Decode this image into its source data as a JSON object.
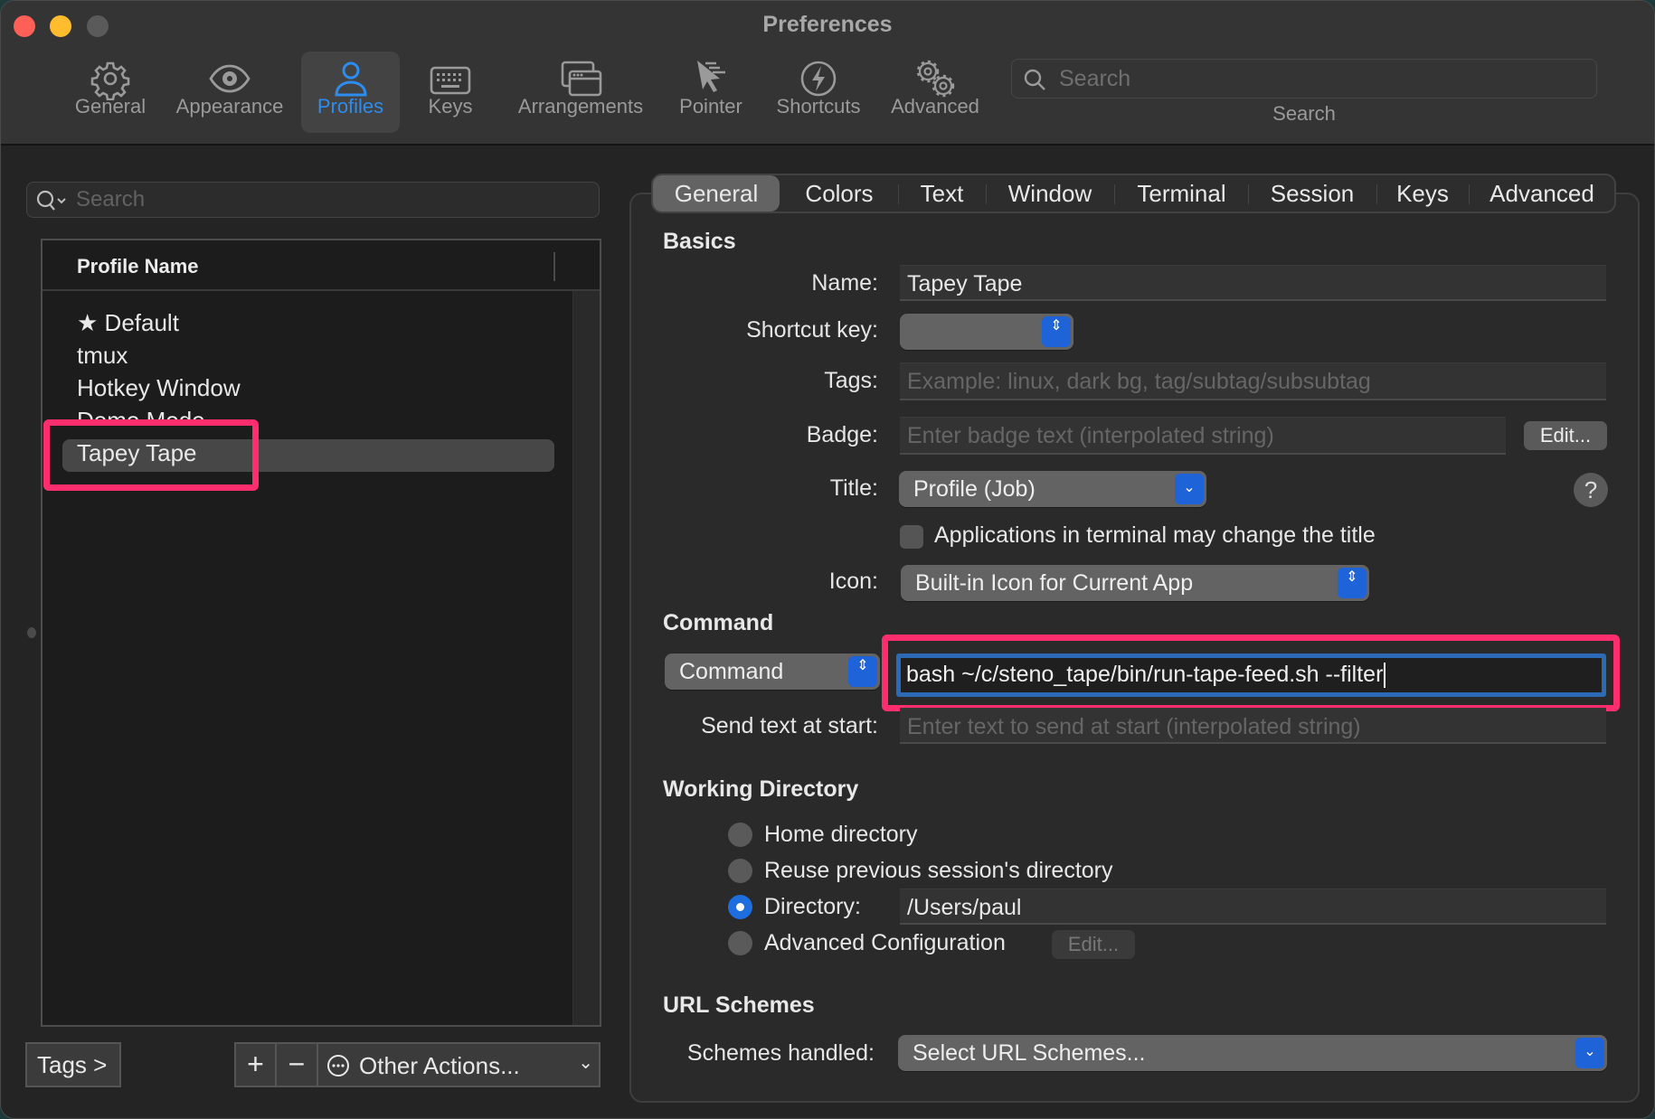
{
  "window": {
    "title": "Preferences"
  },
  "toolbar": {
    "items": [
      {
        "label": "General",
        "icon": "gear-icon"
      },
      {
        "label": "Appearance",
        "icon": "eye-icon"
      },
      {
        "label": "Profiles",
        "icon": "person-icon",
        "active": true
      },
      {
        "label": "Keys",
        "icon": "keyboard-icon"
      },
      {
        "label": "Arrangements",
        "icon": "windows-icon"
      },
      {
        "label": "Pointer",
        "icon": "pointer-icon"
      },
      {
        "label": "Shortcuts",
        "icon": "lightning-icon"
      },
      {
        "label": "Advanced",
        "icon": "gears-icon"
      }
    ],
    "search": {
      "placeholder": "Search",
      "label": "Search"
    }
  },
  "profiles": {
    "search_placeholder": "Search",
    "column_header": "Profile Name",
    "items": [
      {
        "name": "Default",
        "default": true
      },
      {
        "name": "tmux"
      },
      {
        "name": "Hotkey Window"
      },
      {
        "name": "Demo Mode"
      },
      {
        "name": "Tapey Tape",
        "selected": true
      }
    ],
    "tags_button": "Tags >",
    "add_button": "+",
    "remove_button": "−",
    "other_actions": "Other Actions..."
  },
  "tabs": [
    "General",
    "Colors",
    "Text",
    "Window",
    "Terminal",
    "Session",
    "Keys",
    "Advanced"
  ],
  "active_tab": "General",
  "basics": {
    "heading": "Basics",
    "name_label": "Name:",
    "name_value": "Tapey Tape",
    "shortcut_label": "Shortcut key:",
    "shortcut_value": "",
    "tags_label": "Tags:",
    "tags_placeholder": "Example: linux, dark bg, tag/subtag/subsubtag",
    "badge_label": "Badge:",
    "badge_placeholder": "Enter badge text (interpolated string)",
    "badge_edit": "Edit...",
    "title_label": "Title:",
    "title_value": "Profile (Job)",
    "help": "?",
    "apps_change_title_label": "Applications in terminal may change the title",
    "apps_change_title_checked": false,
    "icon_label": "Icon:",
    "icon_value": "Built-in Icon for Current App"
  },
  "command": {
    "heading": "Command",
    "mode_value": "Command",
    "command_value": "bash  ~/c/steno_tape/bin/run-tape-feed.sh --filter",
    "send_text_label": "Send text at start:",
    "send_text_placeholder": "Enter text to send at start (interpolated string)"
  },
  "working_directory": {
    "heading": "Working Directory",
    "options": [
      {
        "label": "Home directory",
        "selected": false
      },
      {
        "label": "Reuse previous session's directory",
        "selected": false
      },
      {
        "label": "Directory:",
        "selected": true
      },
      {
        "label": "Advanced Configuration",
        "selected": false
      }
    ],
    "directory_value": "/Users/paul",
    "advanced_edit": "Edit..."
  },
  "url_schemes": {
    "heading": "URL Schemes",
    "label": "Schemes handled:",
    "value": "Select URL Schemes..."
  },
  "colors": {
    "accent": "#2d8cf0",
    "highlight": "#fe2e6e",
    "popup_button": "#1e63d8"
  }
}
